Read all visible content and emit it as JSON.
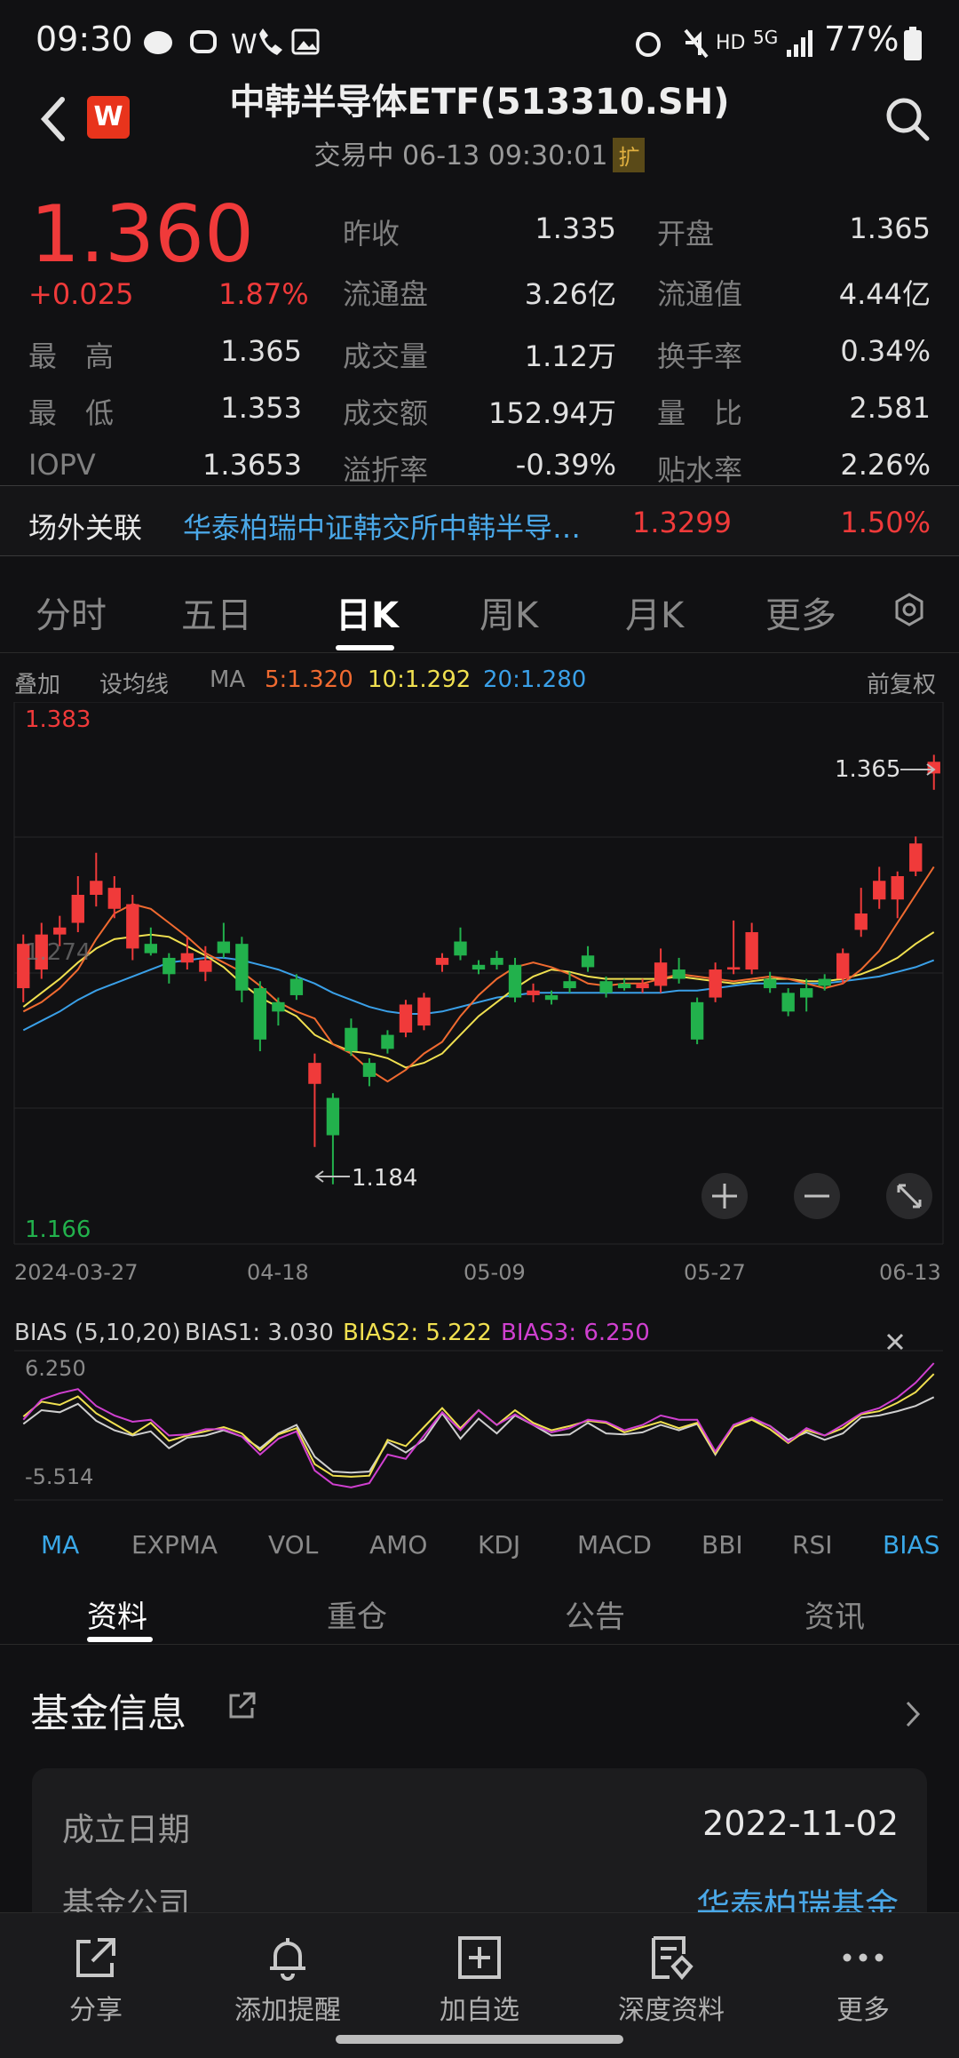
{
  "status_bar": {
    "time": "09:30",
    "net": "HD",
    "sig": "5G",
    "battery": "77%",
    "w": "W"
  },
  "header": {
    "title": "中韩半导体ETF(513310.SH)",
    "subtitle": "交易中 06-13 09:30:01",
    "expand": "扩",
    "logo": "W"
  },
  "quote": {
    "price": "1.360",
    "change": "+0.025",
    "change_pct": "1.87%",
    "high_label": "最　高",
    "high": "1.365",
    "low_label": "最　低",
    "low": "1.353",
    "iopv_label": "IOPV",
    "iopv": "1.3653",
    "prev_close_label": "昨收",
    "prev_close": "1.335",
    "float_shares_label": "流通盘",
    "float_shares": "3.26亿",
    "volume_label": "成交量",
    "volume": "1.12万",
    "amount_label": "成交额",
    "amount": "152.94万",
    "premium_label": "溢折率",
    "premium": "-0.39%",
    "open_label": "开盘",
    "open": "1.365",
    "float_value_label": "流通值",
    "float_value": "4.44亿",
    "turnover_label": "换手率",
    "turnover": "0.34%",
    "vol_ratio_label": "量　比",
    "vol_ratio": "2.581",
    "discount_label": "贴水率",
    "discount": "2.26%"
  },
  "related": {
    "label": "场外关联",
    "name": "华泰柏瑞中证韩交所中韩半导…",
    "price": "1.3299",
    "change": "1.50%"
  },
  "period_tabs": [
    "分时",
    "五日",
    "日K",
    "周K",
    "月K",
    "更多"
  ],
  "ma_bar": {
    "overlay": "叠加",
    "set_ma": "设均线",
    "ma": "MA",
    "ma5": "5:1.320",
    "ma10": "10:1.292",
    "ma20": "20:1.280",
    "adjust": "前复权"
  },
  "chart_labels": {
    "y_high": "1.383",
    "y_low": "1.166",
    "y_mid": "1.274",
    "max_marker": "1.365",
    "min_marker": "1.184",
    "dates": [
      "2024-03-27",
      "04-18",
      "05-09",
      "05-27",
      "06-13"
    ]
  },
  "bias_bar": {
    "title": "BIAS (5,10,20)",
    "bias1": "BIAS1: 3.030",
    "bias2": "BIAS2: 5.222",
    "bias3": "BIAS3: 6.250",
    "y_high": "6.250",
    "y_low": "-5.514"
  },
  "indicator_tabs": [
    "MA",
    "EXPMA",
    "VOL",
    "AMO",
    "KDJ",
    "MACD",
    "BBI",
    "RSI",
    "BIAS"
  ],
  "info_tabs": [
    "资料",
    "重仓",
    "公告",
    "资讯"
  ],
  "fund_info": {
    "title": "基金信息",
    "rows": [
      {
        "label": "成立日期",
        "value": "2022-11-02"
      },
      {
        "label": "基金公司",
        "value": "华泰柏瑞基金"
      }
    ]
  },
  "bottom_nav": [
    {
      "label": "分享",
      "icon": "share-icon"
    },
    {
      "label": "添加提醒",
      "icon": "bell-icon"
    },
    {
      "label": "加自选",
      "icon": "add-watchlist-icon"
    },
    {
      "label": "深度资料",
      "icon": "report-icon"
    },
    {
      "label": "更多",
      "icon": "more-icon"
    }
  ],
  "colors": {
    "up": "#f03a3a",
    "down": "#22b14c",
    "ma5": "#f06a30",
    "ma10": "#f0e050",
    "ma20": "#3aa0e8",
    "bias3": "#d040d0",
    "accent": "#3aa8e8"
  },
  "chart_data": {
    "type": "candlestick",
    "title": "",
    "ylim": [
      1.166,
      1.383
    ],
    "x_ticks": [
      "2024-03-27",
      "04-18",
      "05-09",
      "05-27",
      "06-13"
    ],
    "candles": [
      {
        "o": 1.268,
        "c": 1.287,
        "h": 1.291,
        "l": 1.262
      },
      {
        "o": 1.276,
        "c": 1.291,
        "h": 1.296,
        "l": 1.272
      },
      {
        "o": 1.291,
        "c": 1.294,
        "h": 1.299,
        "l": 1.286
      },
      {
        "o": 1.296,
        "c": 1.308,
        "h": 1.316,
        "l": 1.292
      },
      {
        "o": 1.308,
        "c": 1.314,
        "h": 1.326,
        "l": 1.303
      },
      {
        "o": 1.302,
        "c": 1.311,
        "h": 1.316,
        "l": 1.298
      },
      {
        "o": 1.285,
        "c": 1.304,
        "h": 1.308,
        "l": 1.28
      },
      {
        "o": 1.287,
        "c": 1.283,
        "h": 1.294,
        "l": 1.282
      },
      {
        "o": 1.281,
        "c": 1.274,
        "h": 1.283,
        "l": 1.27
      },
      {
        "o": 1.279,
        "c": 1.283,
        "h": 1.29,
        "l": 1.276
      },
      {
        "o": 1.275,
        "c": 1.28,
        "h": 1.286,
        "l": 1.271
      },
      {
        "o": 1.288,
        "c": 1.283,
        "h": 1.296,
        "l": 1.281
      },
      {
        "o": 1.287,
        "c": 1.267,
        "h": 1.29,
        "l": 1.262
      },
      {
        "o": 1.268,
        "c": 1.246,
        "h": 1.271,
        "l": 1.241
      },
      {
        "o": 1.262,
        "c": 1.258,
        "h": 1.264,
        "l": 1.252
      },
      {
        "o": 1.272,
        "c": 1.265,
        "h": 1.274,
        "l": 1.263
      },
      {
        "o": 1.227,
        "c": 1.236,
        "h": 1.24,
        "l": 1.2
      },
      {
        "o": 1.221,
        "c": 1.205,
        "h": 1.223,
        "l": 1.184
      },
      {
        "o": 1.251,
        "c": 1.241,
        "h": 1.255,
        "l": 1.239
      },
      {
        "o": 1.236,
        "c": 1.23,
        "h": 1.238,
        "l": 1.226
      },
      {
        "o": 1.248,
        "c": 1.242,
        "h": 1.25,
        "l": 1.24
      },
      {
        "o": 1.249,
        "c": 1.261,
        "h": 1.263,
        "l": 1.247
      },
      {
        "o": 1.252,
        "c": 1.264,
        "h": 1.266,
        "l": 1.25
      },
      {
        "o": 1.278,
        "c": 1.281,
        "h": 1.283,
        "l": 1.275
      },
      {
        "o": 1.288,
        "c": 1.282,
        "h": 1.294,
        "l": 1.28
      },
      {
        "o": 1.278,
        "c": 1.276,
        "h": 1.28,
        "l": 1.274
      },
      {
        "o": 1.281,
        "c": 1.278,
        "h": 1.284,
        "l": 1.276
      },
      {
        "o": 1.278,
        "c": 1.264,
        "h": 1.281,
        "l": 1.262
      },
      {
        "o": 1.265,
        "c": 1.267,
        "h": 1.27,
        "l": 1.262
      },
      {
        "o": 1.265,
        "c": 1.263,
        "h": 1.267,
        "l": 1.261
      },
      {
        "o": 1.271,
        "c": 1.268,
        "h": 1.275,
        "l": 1.266
      },
      {
        "o": 1.282,
        "c": 1.277,
        "h": 1.286,
        "l": 1.275
      },
      {
        "o": 1.271,
        "c": 1.266,
        "h": 1.273,
        "l": 1.264
      },
      {
        "o": 1.27,
        "c": 1.268,
        "h": 1.272,
        "l": 1.267
      },
      {
        "o": 1.268,
        "c": 1.27,
        "h": 1.272,
        "l": 1.266
      },
      {
        "o": 1.269,
        "c": 1.279,
        "h": 1.285,
        "l": 1.266
      },
      {
        "o": 1.276,
        "c": 1.272,
        "h": 1.281,
        "l": 1.27
      },
      {
        "o": 1.262,
        "c": 1.246,
        "h": 1.264,
        "l": 1.244
      },
      {
        "o": 1.264,
        "c": 1.276,
        "h": 1.279,
        "l": 1.262
      },
      {
        "o": 1.276,
        "c": 1.277,
        "h": 1.297,
        "l": 1.274
      },
      {
        "o": 1.276,
        "c": 1.292,
        "h": 1.296,
        "l": 1.274
      },
      {
        "o": 1.272,
        "c": 1.268,
        "h": 1.275,
        "l": 1.266
      },
      {
        "o": 1.266,
        "c": 1.258,
        "h": 1.268,
        "l": 1.256
      },
      {
        "o": 1.268,
        "c": 1.264,
        "h": 1.272,
        "l": 1.258
      },
      {
        "o": 1.272,
        "c": 1.269,
        "h": 1.274,
        "l": 1.267
      },
      {
        "o": 1.272,
        "c": 1.283,
        "h": 1.285,
        "l": 1.27
      },
      {
        "o": 1.293,
        "c": 1.3,
        "h": 1.311,
        "l": 1.29
      },
      {
        "o": 1.306,
        "c": 1.314,
        "h": 1.32,
        "l": 1.302
      },
      {
        "o": 1.306,
        "c": 1.316,
        "h": 1.318,
        "l": 1.298
      },
      {
        "o": 1.318,
        "c": 1.33,
        "h": 1.333,
        "l": 1.316
      },
      {
        "o": 1.36,
        "c": 1.365,
        "h": 1.368,
        "l": 1.353
      }
    ],
    "ma5_values": [
      1.258,
      1.262,
      1.268,
      1.276,
      1.289,
      1.3,
      1.304,
      1.302,
      1.296,
      1.29,
      1.283,
      1.279,
      1.275,
      1.269,
      1.262,
      1.258,
      1.255,
      1.244,
      1.24,
      1.233,
      1.228,
      1.233,
      1.24,
      1.245,
      1.256,
      1.265,
      1.272,
      1.277,
      1.279,
      1.277,
      1.274,
      1.27,
      1.269,
      1.27,
      1.27,
      1.272,
      1.274,
      1.273,
      1.272,
      1.271,
      1.272,
      1.273,
      1.272,
      1.27,
      1.268,
      1.27,
      1.276,
      1.284,
      1.296,
      1.308,
      1.32
    ],
    "ma10_values": [
      1.26,
      1.266,
      1.272,
      1.279,
      1.285,
      1.289,
      1.29,
      1.291,
      1.29,
      1.286,
      1.282,
      1.277,
      1.27,
      1.264,
      1.26,
      1.256,
      1.248,
      1.244,
      1.241,
      1.24,
      1.238,
      1.234,
      1.236,
      1.24,
      1.248,
      1.256,
      1.262,
      1.268,
      1.273,
      1.276,
      1.275,
      1.273,
      1.272,
      1.272,
      1.272,
      1.272,
      1.273,
      1.272,
      1.271,
      1.27,
      1.271,
      1.272,
      1.272,
      1.271,
      1.271,
      1.272,
      1.274,
      1.277,
      1.281,
      1.287,
      1.292
    ],
    "ma20_values": [
      1.25,
      1.254,
      1.258,
      1.263,
      1.267,
      1.27,
      1.273,
      1.276,
      1.279,
      1.28,
      1.281,
      1.281,
      1.28,
      1.278,
      1.276,
      1.273,
      1.27,
      1.266,
      1.263,
      1.26,
      1.258,
      1.257,
      1.257,
      1.258,
      1.26,
      1.262,
      1.264,
      1.265,
      1.266,
      1.266,
      1.266,
      1.266,
      1.266,
      1.266,
      1.266,
      1.266,
      1.267,
      1.267,
      1.268,
      1.269,
      1.27,
      1.27,
      1.27,
      1.27,
      1.27,
      1.271,
      1.272,
      1.273,
      1.275,
      1.277,
      1.28
    ],
    "bias": {
      "ylim": [
        -5.514,
        6.25
      ],
      "bias1": [
        0.5,
        1.8,
        1.6,
        2.4,
        0.8,
        -0.1,
        -0.6,
        -0.2,
        -1.8,
        -0.8,
        -0.6,
        -0.1,
        -0.7,
        -1.8,
        -0.4,
        0.4,
        -2.6,
        -4.0,
        -4.1,
        -4.0,
        -1.2,
        -2.2,
        -1.0,
        1.5,
        -0.9,
        1.0,
        -0.4,
        1.3,
        0.4,
        -0.6,
        -0.5,
        0.6,
        -0.4,
        -0.5,
        -0.3,
        0.4,
        -0.1,
        0.5,
        -2.4,
        0.4,
        1.0,
        0.3,
        -1.0,
        -0.3,
        -1.0,
        -0.4,
        1.1,
        1.3,
        1.7,
        2.2,
        3.03
      ],
      "bias2": [
        1.2,
        2.6,
        2.3,
        3.1,
        1.5,
        0.5,
        -0.5,
        0.6,
        -1.1,
        -0.6,
        -0.2,
        0.2,
        -0.4,
        -2.0,
        -0.5,
        0.1,
        -3.3,
        -4.4,
        -4.5,
        -4.4,
        -1.0,
        -1.6,
        0.2,
        2.0,
        0.1,
        1.8,
        0.4,
        1.8,
        0.6,
        -0.1,
        0.3,
        0.8,
        0.6,
        -0.3,
        0.2,
        0.7,
        0.1,
        0.6,
        -2.3,
        0.2,
        0.9,
        0.0,
        -1.3,
        -0.1,
        -0.6,
        0.1,
        1.4,
        1.7,
        2.5,
        3.5,
        5.222
      ],
      "bias3": [
        0.9,
        2.8,
        3.4,
        3.8,
        2.2,
        1.3,
        0.7,
        0.9,
        -0.6,
        -0.5,
        0.0,
        0.0,
        -0.7,
        -2.4,
        -0.9,
        -0.2,
        -3.9,
        -5.2,
        -5.5,
        -5.1,
        -2.4,
        -2.8,
        -0.6,
        1.6,
        -0.1,
        1.8,
        0.4,
        1.4,
        0.4,
        -0.3,
        0.1,
        0.9,
        0.7,
        -0.1,
        0.4,
        1.3,
        0.9,
        0.9,
        -2.1,
        0.4,
        1.1,
        0.3,
        -1.2,
        0.1,
        -0.6,
        0.4,
        1.5,
        2.0,
        3.0,
        4.4,
        6.25
      ]
    }
  }
}
